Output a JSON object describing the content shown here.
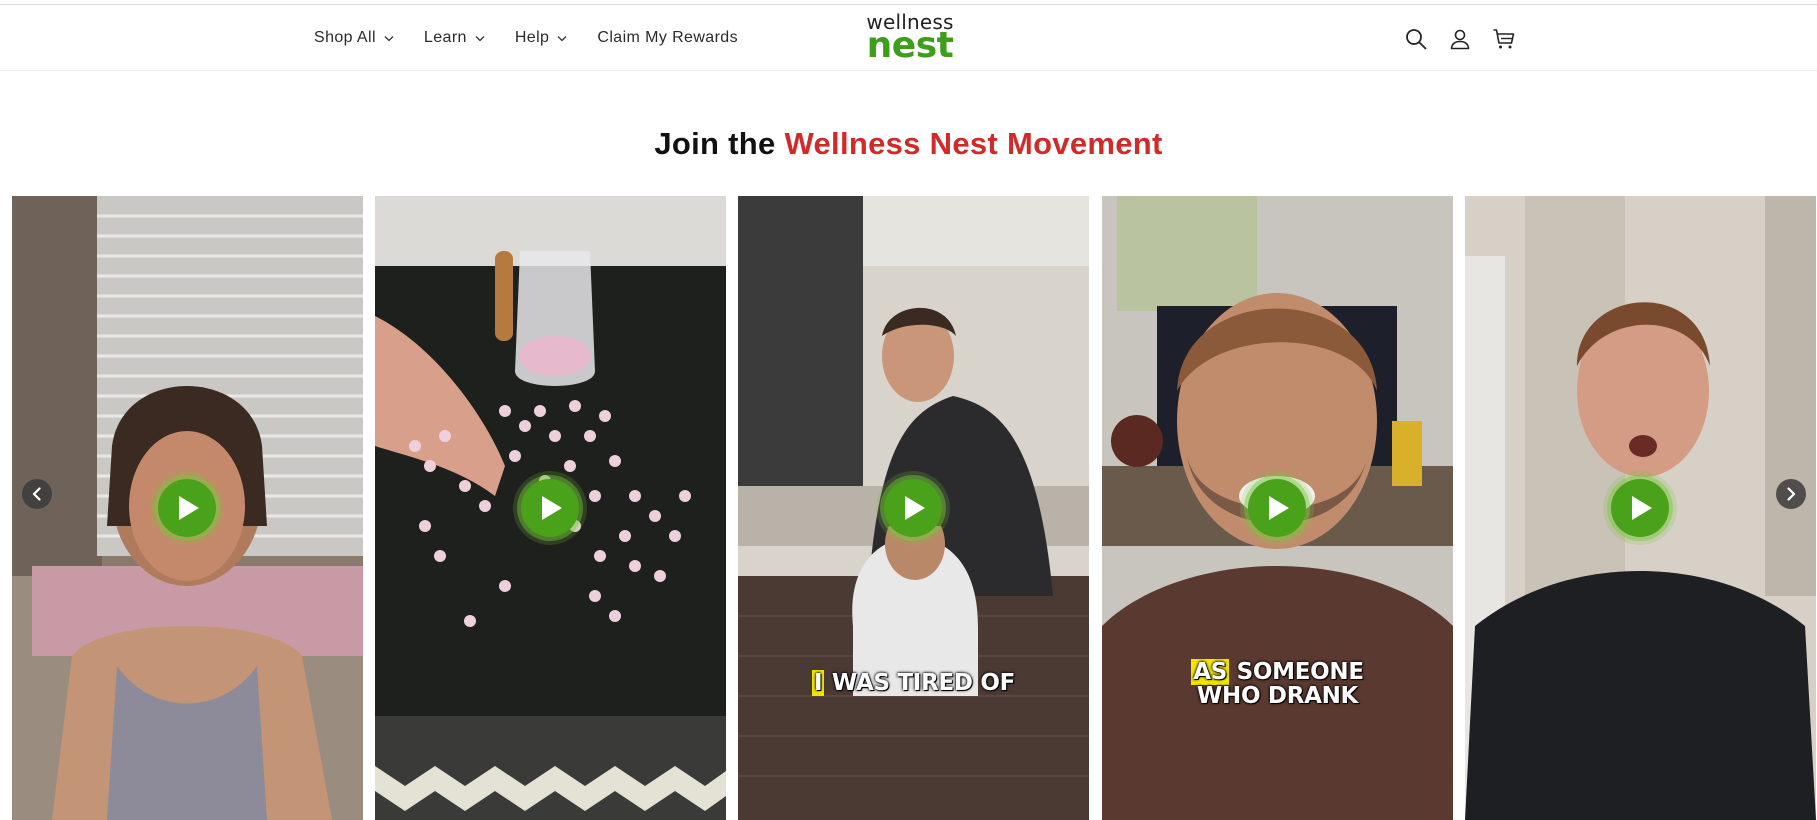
{
  "header": {
    "nav": [
      {
        "label": "Shop All",
        "has_dropdown": true
      },
      {
        "label": "Learn",
        "has_dropdown": true
      },
      {
        "label": "Help",
        "has_dropdown": true
      },
      {
        "label": "Claim My Rewards",
        "has_dropdown": false
      }
    ],
    "logo": {
      "line1": "wellness",
      "line2": "nest",
      "color": "#3e9e1b"
    },
    "icons": [
      "search-icon",
      "account-icon",
      "cart-icon"
    ]
  },
  "section": {
    "title_plain": "Join the ",
    "title_accent": "Wellness Nest Movement",
    "accent_color": "#d12a2a"
  },
  "videos": [
    {
      "caption_highlight": "",
      "caption_rest": ""
    },
    {
      "caption_highlight": "",
      "caption_rest": ""
    },
    {
      "caption_highlight": "I",
      "caption_rest": " WAS TIRED OF"
    },
    {
      "caption_highlight": "AS",
      "caption_rest": " SOMEONE WHO DRANK"
    },
    {
      "caption_highlight": "",
      "caption_rest": ""
    }
  ],
  "carousel": {
    "prev_icon": "chevron-left-icon",
    "next_icon": "chevron-right-icon",
    "play_icon": "play-icon",
    "play_color": "#4aa11a"
  }
}
